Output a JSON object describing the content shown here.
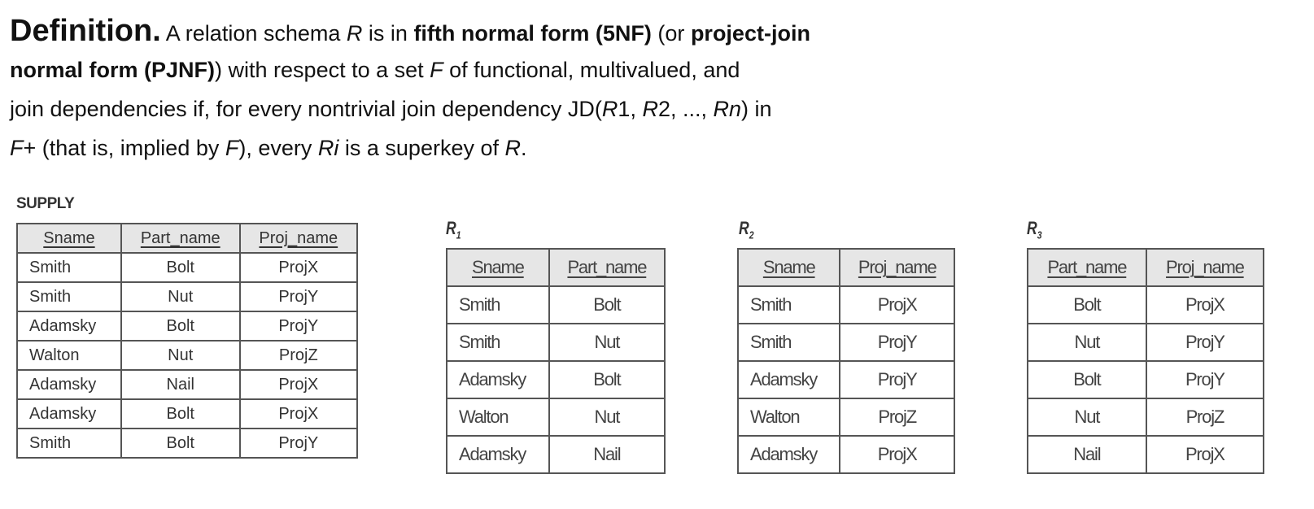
{
  "definition": {
    "lines": [
      [
        {
          "t": "Definition.",
          "s": "big"
        },
        {
          "t": " A relation schema ",
          "s": ""
        },
        {
          "t": "R",
          "s": "i"
        },
        {
          "t": " is in ",
          "s": ""
        },
        {
          "t": "fifth normal form (5NF)",
          "s": "b"
        },
        {
          "t": " (or ",
          "s": ""
        },
        {
          "t": "project-join",
          "s": "b"
        }
      ],
      [
        {
          "t": "normal form (PJNF)",
          "s": "b"
        },
        {
          "t": ") with respect to a set ",
          "s": ""
        },
        {
          "t": "F",
          "s": "i"
        },
        {
          "t": " of functional, multivalued, and",
          "s": ""
        }
      ],
      [
        {
          "t": "join dependencies if, for every nontrivial join dependency JD(",
          "s": ""
        },
        {
          "t": "R",
          "s": "i"
        },
        {
          "t": "1, ",
          "s": ""
        },
        {
          "t": "R",
          "s": "i"
        },
        {
          "t": "2, ..., ",
          "s": ""
        },
        {
          "t": "Rn",
          "s": "i"
        },
        {
          "t": ") in",
          "s": ""
        }
      ],
      [
        {
          "t": "F",
          "s": "i"
        },
        {
          "t": "+ (that is, implied by ",
          "s": ""
        },
        {
          "t": "F",
          "s": "i"
        },
        {
          "t": "), every ",
          "s": ""
        },
        {
          "t": "Ri",
          "s": "i"
        },
        {
          "t": " is a superkey of ",
          "s": ""
        },
        {
          "t": "R",
          "s": "i"
        },
        {
          "t": ".",
          "s": ""
        }
      ]
    ]
  },
  "tables": [
    {
      "id": "supply",
      "label": "SUPPLY",
      "sub": "",
      "headers": [
        "Sname",
        "Part_name",
        "Proj_name"
      ],
      "rows": [
        [
          "Smith",
          "Bolt",
          "ProjX"
        ],
        [
          "Smith",
          "Nut",
          "ProjY"
        ],
        [
          "Adamsky",
          "Bolt",
          "ProjY"
        ],
        [
          "Walton",
          "Nut",
          "ProjZ"
        ],
        [
          "Adamsky",
          "Nail",
          "ProjX"
        ],
        [
          "Adamsky",
          "Bolt",
          "ProjX"
        ],
        [
          "Smith",
          "Bolt",
          "ProjY"
        ]
      ],
      "dashed_before_row": 5
    },
    {
      "id": "r1",
      "label": "R",
      "sub": "1",
      "headers": [
        "Sname",
        "Part_name"
      ],
      "rows": [
        [
          "Smith",
          "Bolt"
        ],
        [
          "Smith",
          "Nut"
        ],
        [
          "Adamsky",
          "Bolt"
        ],
        [
          "Walton",
          "Nut"
        ],
        [
          "Adamsky",
          "Nail"
        ]
      ]
    },
    {
      "id": "r2",
      "label": "R",
      "sub": "2",
      "headers": [
        "Sname",
        "Proj_name"
      ],
      "rows": [
        [
          "Smith",
          "ProjX"
        ],
        [
          "Smith",
          "ProjY"
        ],
        [
          "Adamsky",
          "ProjY"
        ],
        [
          "Walton",
          "ProjZ"
        ],
        [
          "Adamsky",
          "ProjX"
        ]
      ]
    },
    {
      "id": "r3",
      "label": "R",
      "sub": "3",
      "headers": [
        "Part_name",
        "Proj_name"
      ],
      "rows": [
        [
          "Bolt",
          "ProjX"
        ],
        [
          "Nut",
          "ProjY"
        ],
        [
          "Bolt",
          "ProjY"
        ],
        [
          "Nut",
          "ProjZ"
        ],
        [
          "Nail",
          "ProjX"
        ]
      ]
    }
  ]
}
